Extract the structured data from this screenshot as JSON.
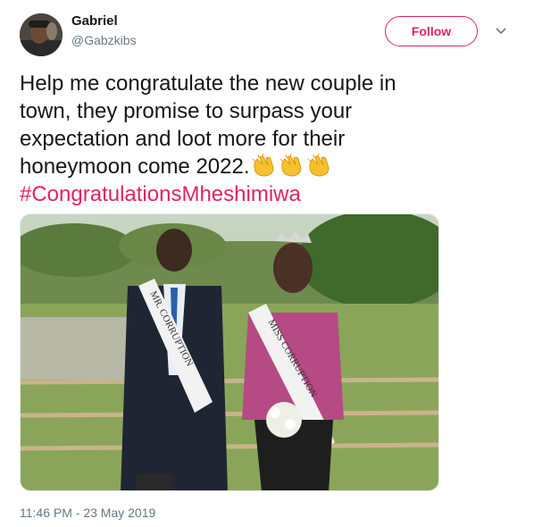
{
  "author": {
    "name": "Gabriel",
    "handle": "@Gabzkibs",
    "avatar_icon": "user-avatar-photo"
  },
  "follow_button": {
    "label": "Follow",
    "color": "#e0245e"
  },
  "menu_icon": "chevron-down-icon",
  "tweet": {
    "text": "Help me congratulate the new couple in\ntown, they promise to surpass your\nexpectation  and loot more for their\nhoneymoon come 2022.",
    "emoji": [
      "clapping-hands-emoji",
      "clapping-hands-emoji",
      "clapping-hands-emoji"
    ],
    "hashtag": "#CongratulationsMheshimiwa",
    "hashtag_color": "#e0245e"
  },
  "photo": {
    "sash_left": "MR. CORRUPTION",
    "sash_right": "MISS CORRUPTION"
  },
  "timestamp": "11:46 PM - 23 May 2019"
}
